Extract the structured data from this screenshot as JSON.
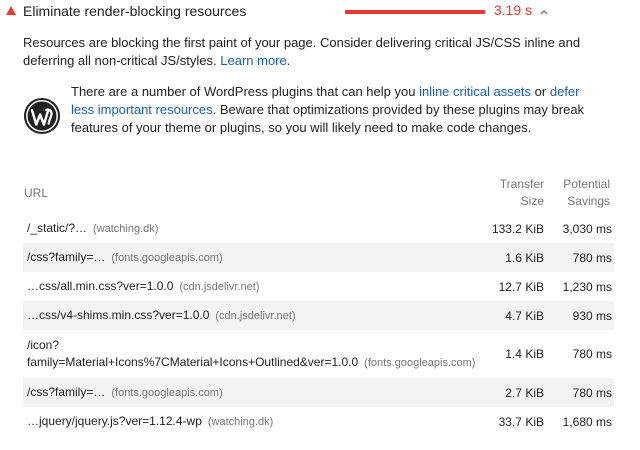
{
  "audit": {
    "title": "Eliminate render-blocking resources",
    "display_value": "3.19 s",
    "description": "Resources are blocking the first paint of your page. Consider delivering critical JS/CSS inline and deferring all non-critical JS/styles.",
    "learn_more": "Learn more",
    "learn_more_suffix": ".",
    "colors": {
      "fail": "#e53935",
      "link": "#1a5fb4"
    }
  },
  "wordpress": {
    "icon": "wordpress-icon",
    "text_1": "There are a number of WordPress plugins that can help you ",
    "link_1": "inline critical assets",
    "text_2": " or ",
    "link_2": "defer less important resources",
    "text_3": ". Beware that optimizations provided by these plugins may break features of your theme or plugins, so you will likely need to make code changes."
  },
  "table": {
    "headers": {
      "url": "URL",
      "transfer_1": "Transfer",
      "transfer_2": "Size",
      "savings_1": "Potential",
      "savings_2": "Savings"
    },
    "rows": [
      {
        "path": "/_static/?…",
        "host": "(watching.dk)",
        "size": "133.2 KiB",
        "savings": "3,030 ms"
      },
      {
        "path": "/css?family=…",
        "host": "(fonts.googleapis.com)",
        "size": "1.6 KiB",
        "savings": "780 ms"
      },
      {
        "path": "…css/all.min.css?ver=1.0.0",
        "host": "(cdn.jsdelivr.net)",
        "size": "12.7 KiB",
        "savings": "1,230 ms"
      },
      {
        "path": "…css/v4-shims.min.css?ver=1.0.0",
        "host": "(cdn.jsdelivr.net)",
        "size": "4.7 KiB",
        "savings": "930 ms"
      },
      {
        "path_1": "/icon?",
        "path_2": "family=Material+Icons%7CMaterial+Icons+Outlined&ver=1.0.0",
        "host": "(fonts.googleapis.com)",
        "size": "1.4 KiB",
        "savings": "780 ms"
      },
      {
        "path": "/css?family=…",
        "host": "(fonts.googleapis.com)",
        "size": "2.7 KiB",
        "savings": "780 ms"
      },
      {
        "path": "…jquery/jquery.js?ver=1.12.4-wp",
        "host": "(watching.dk)",
        "size": "33.7 KiB",
        "savings": "1,680 ms"
      }
    ]
  }
}
